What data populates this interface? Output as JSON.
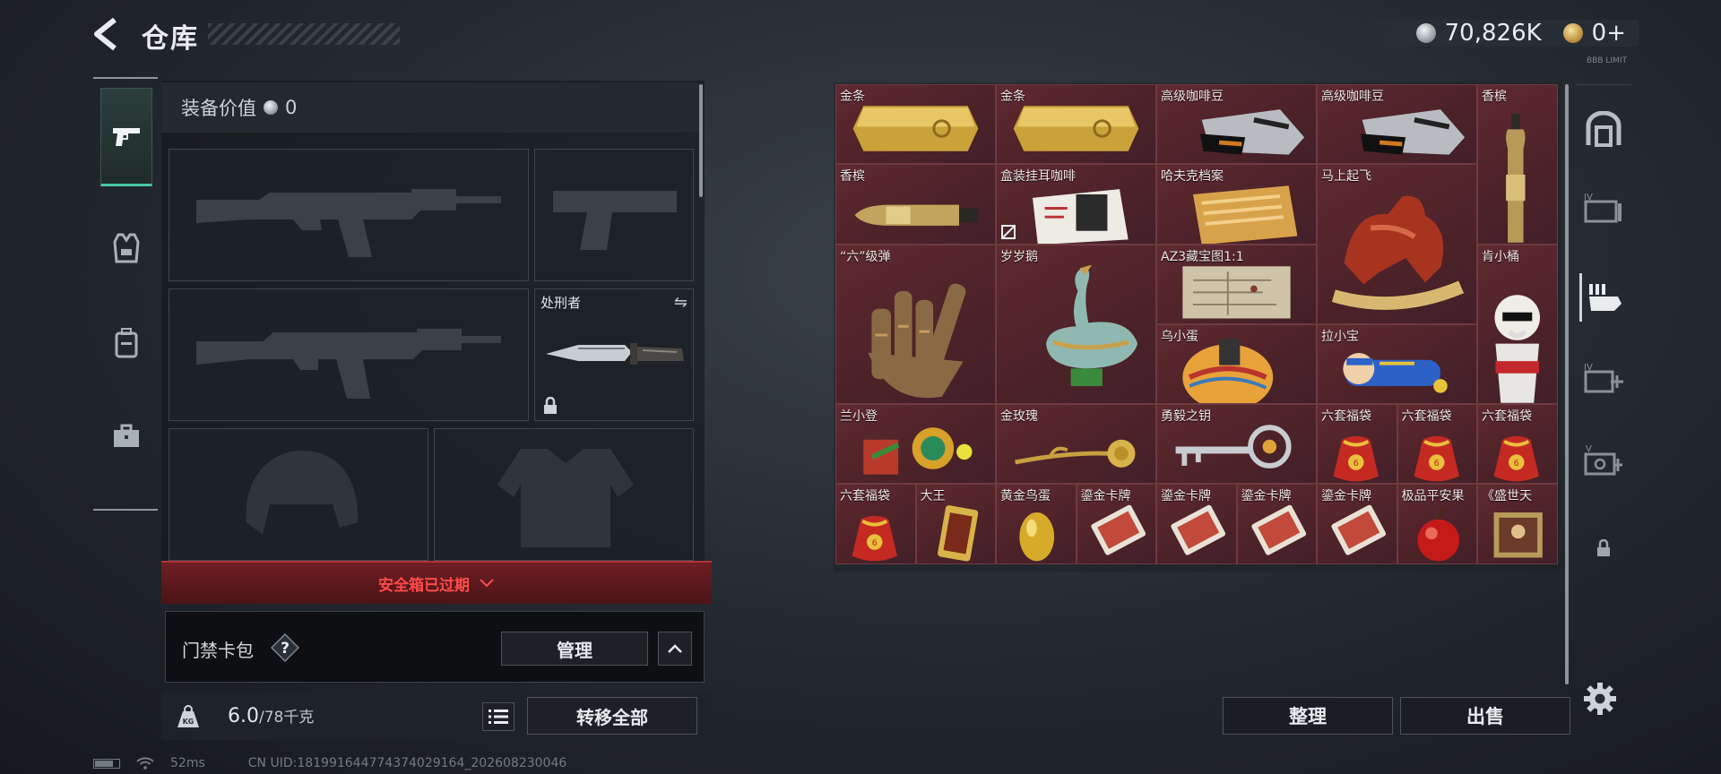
{
  "header": {
    "title": "仓库"
  },
  "currency": {
    "silver": "70,826K",
    "gold": "0+",
    "tiny_label": "BBB LIMIT"
  },
  "loadout": {
    "equip_value_label": "装备价值",
    "equip_value": "0",
    "knife_name": "处刑者",
    "safebox_status": "安全箱已过期",
    "keycard_label": "门禁卡包",
    "manage_label": "管理",
    "weight_current": "6.0",
    "weight_max": "/78千克",
    "transfer_label": "转移全部"
  },
  "status": {
    "ping": "52ms",
    "uid": "CN UID:181991644774374029164_202608230046"
  },
  "stash": {
    "sort_label": "整理",
    "sell_label": "出售",
    "items": [
      {
        "label": "金条",
        "icon": "gold-bar"
      },
      {
        "label": "金条",
        "icon": "gold-bar"
      },
      {
        "label": "高级咖啡豆",
        "icon": "coffee-bag"
      },
      {
        "label": "高级咖啡豆",
        "icon": "coffee-bag"
      },
      {
        "label": "香槟",
        "icon": "champagne-upright"
      },
      {
        "label": "香槟",
        "icon": "champagne-lying"
      },
      {
        "label": "盒装挂耳咖啡",
        "icon": "coffee-box"
      },
      {
        "label": "哈夫克档案",
        "icon": "dossier"
      },
      {
        "label": "马上起飞",
        "icon": "horse-statue"
      },
      {
        "label": "“六”级弹",
        "icon": "bullet-hand"
      },
      {
        "label": "岁岁鹅",
        "icon": "goose-statue"
      },
      {
        "label": "AZ3藏宝图1:1",
        "icon": "treasure-map"
      },
      {
        "label": "肯小桶",
        "icon": "kfc-bucket"
      },
      {
        "label": "乌小蛋",
        "icon": "painted-egg"
      },
      {
        "label": "拉小宝",
        "icon": "doll"
      },
      {
        "label": "兰小登",
        "icon": "colorful-figure"
      },
      {
        "label": "金玫瑰",
        "icon": "gold-rose"
      },
      {
        "label": "勇毅之钥",
        "icon": "key"
      },
      {
        "label": "六套福袋",
        "icon": "lucky-bag"
      },
      {
        "label": "六套福袋",
        "icon": "lucky-bag"
      },
      {
        "label": "六套福袋",
        "icon": "lucky-bag"
      },
      {
        "label": "六套福袋",
        "icon": "lucky-bag"
      },
      {
        "label": "大王",
        "icon": "king-card"
      },
      {
        "label": "黄金鸟蛋",
        "icon": "gold-egg"
      },
      {
        "label": "鎏金卡牌",
        "icon": "gilded-card"
      },
      {
        "label": "鎏金卡牌",
        "icon": "gilded-card"
      },
      {
        "label": "鎏金卡牌",
        "icon": "gilded-card"
      },
      {
        "label": "鎏金卡牌",
        "icon": "gilded-card"
      },
      {
        "label": "极品平安果",
        "icon": "apple"
      },
      {
        "label": "《盛世天",
        "icon": "painting"
      }
    ]
  },
  "colors": {
    "accent": "#48c6a8",
    "danger": "#ff4b4b",
    "rare_bg": "#5a2a30"
  }
}
